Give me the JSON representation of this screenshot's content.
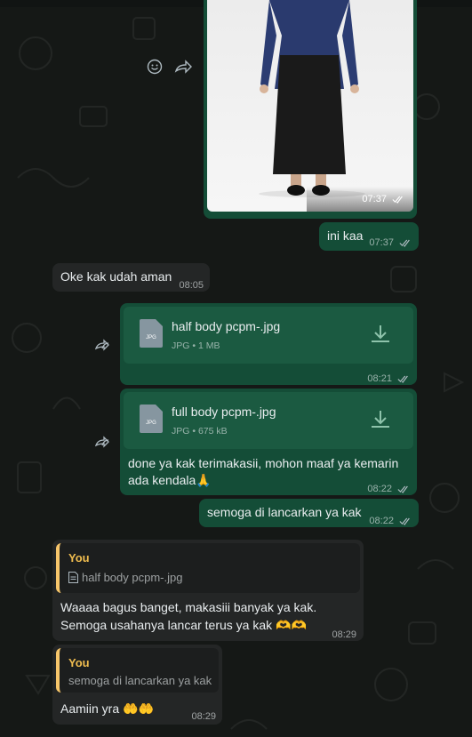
{
  "messages": [
    {
      "id": "photo",
      "direction": "out",
      "type": "image",
      "time": "07:37",
      "status": "read"
    },
    {
      "id": "m1",
      "direction": "out",
      "text": "ini kaa",
      "time": "07:37",
      "status": "read"
    },
    {
      "id": "m2",
      "direction": "in",
      "text": "Oke kak udah aman",
      "time": "08:05"
    },
    {
      "id": "d1",
      "direction": "out",
      "type": "document",
      "file_name": "half body pcpm-.jpg",
      "file_type": "JPG",
      "file_size": "1 MB",
      "time": "08:21",
      "status": "read",
      "forwarded": true
    },
    {
      "id": "d2",
      "direction": "out",
      "type": "document",
      "file_name": "full body pcpm-.jpg",
      "file_type": "JPG",
      "file_size": "675 kB",
      "caption_line1": "done ya kak terimakasii, mohon maaf ya kemarin",
      "caption_line2": "ada kendala🙏",
      "time": "08:22",
      "status": "read",
      "forwarded": true
    },
    {
      "id": "m3",
      "direction": "out",
      "text": "semoga di lancarkan ya kak",
      "time": "08:22",
      "status": "read"
    },
    {
      "id": "m4",
      "direction": "in",
      "quote_author": "You",
      "quote_text": "half body pcpm-.jpg",
      "text_line1": "Waaaa bagus banget, makasiii banyak ya kak.",
      "text_line2": "Semoga usahanya lancar terus ya kak 🫶🫶",
      "time": "08:29"
    },
    {
      "id": "m5",
      "direction": "in",
      "quote_author": "You",
      "quote_text": "semoga di lancarkan ya kak",
      "text": "Aamiin yra 🤲🤲",
      "time": "08:29"
    }
  ],
  "colors": {
    "background": "#151816",
    "outgoing_bubble": "#144d37",
    "incoming_bubble": "#242626",
    "quote_accent": "#f7c66a",
    "quote_author": "#f0bd4f"
  },
  "icons": [
    "emoji-react-icon",
    "forward-icon",
    "document-icon",
    "download-icon",
    "read-ticks-icon"
  ]
}
